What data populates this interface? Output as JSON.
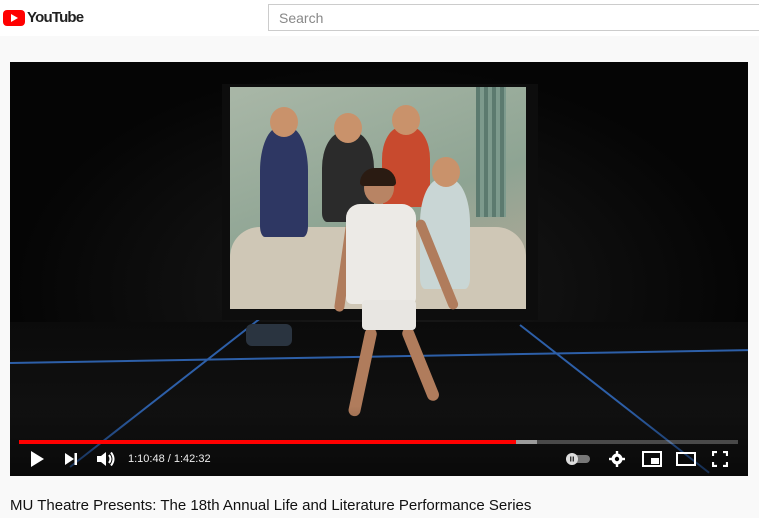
{
  "header": {
    "logo_text": "YouTube",
    "search_placeholder": "Search"
  },
  "player": {
    "current_time": "1:10:48",
    "separator": " / ",
    "duration": "1:42:32",
    "progress_fraction": 0.691,
    "buffer_fraction": 0.72,
    "progress_color": "#ff0000",
    "icons": [
      "play-icon",
      "next-icon",
      "volume-icon",
      "autoplay-toggle-icon",
      "settings-gear-icon",
      "miniplayer-icon",
      "theater-mode-icon",
      "fullscreen-icon"
    ]
  },
  "video": {
    "title": "MU Theatre Presents: The 18th Annual Life and Literature Performance Series"
  }
}
